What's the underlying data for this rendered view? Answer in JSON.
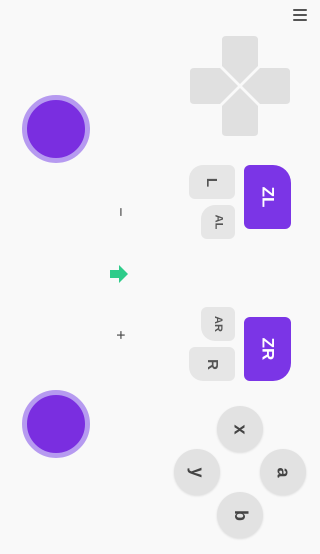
{
  "header": {
    "menu_icon": "hamburger-menu-icon"
  },
  "left_side": {
    "top_stick": "left-joystick",
    "bottom_stick": "right-joystick",
    "minus_label": "−",
    "plus_label": "+",
    "home_icon": "arrow-right-icon",
    "accent": "#2ecc8a"
  },
  "dpad": {
    "icon": "dpad"
  },
  "shoulders_left": {
    "l_label": "L",
    "al_label": "AL",
    "zl_label": "ZL"
  },
  "shoulders_right": {
    "ar_label": "AR",
    "r_label": "R",
    "zr_label": "ZR"
  },
  "face_buttons": {
    "x_label": "x",
    "y_label": "y",
    "a_label": "a",
    "b_label": "b"
  },
  "colors": {
    "purple": "#7b35e6",
    "grey": "#e6e6e6",
    "stick_ring": "#b69af0"
  }
}
